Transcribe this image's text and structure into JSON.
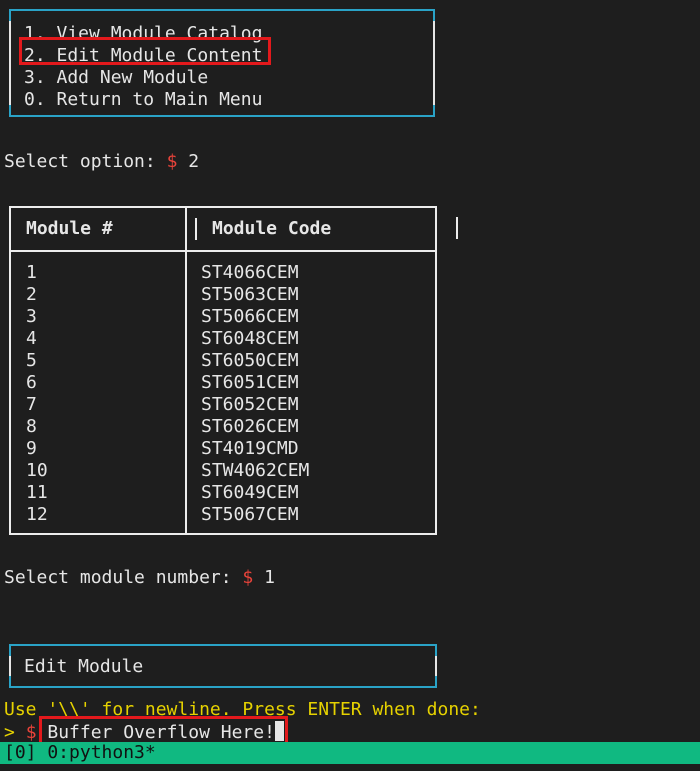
{
  "menu": {
    "items": [
      "1. View Module Catalog",
      "2. Edit Module Content",
      "3. Add New Module",
      "0. Return to Main Menu"
    ]
  },
  "select_option": {
    "label": "Select option: ",
    "dollar": "$",
    "value": " 2"
  },
  "table": {
    "headers": [
      "Module #",
      "Module Code"
    ],
    "rows": [
      [
        "1",
        "ST4066CEM"
      ],
      [
        "2",
        "ST5063CEM"
      ],
      [
        "3",
        "ST5066CEM"
      ],
      [
        "4",
        "ST6048CEM"
      ],
      [
        "5",
        "ST6050CEM"
      ],
      [
        "6",
        "ST6051CEM"
      ],
      [
        "7",
        "ST6052CEM"
      ],
      [
        "8",
        "ST6026CEM"
      ],
      [
        "9",
        "ST4019CMD"
      ],
      [
        "10",
        "STW4062CEM"
      ],
      [
        "11",
        "ST6049CEM"
      ],
      [
        "12",
        "ST5067CEM"
      ]
    ]
  },
  "select_module": {
    "label": "Select module number: ",
    "dollar": "$",
    "value": " 1"
  },
  "edit_box": {
    "title": "Edit Module"
  },
  "instruction": "Use '\\\\' for newline. Press ENTER when done:",
  "input_line": {
    "prompt": "> ",
    "dollar": "$",
    "value": " Buffer Overflow Here!"
  },
  "status_bar": {
    "text": "[0] 0:python3*"
  },
  "colors": {
    "accent_cyan": "#2aa3c7",
    "highlight_red": "#e3191c",
    "dollar_red": "#e8433a",
    "instruction_yellow": "#e6d200",
    "status_green": "#10b981"
  }
}
